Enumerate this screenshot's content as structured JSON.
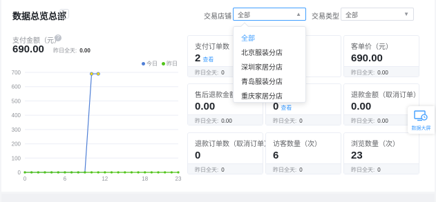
{
  "header": {
    "title": "数据总览总部",
    "store_label": "交易店铺",
    "store_value": "全部",
    "type_label": "交易类型",
    "type_value": "全部"
  },
  "store_dropdown": {
    "options": [
      "全部",
      "北京服装分店",
      "深圳家居分店",
      "青岛服装分店",
      "重庆家居分店"
    ],
    "selected": "全部"
  },
  "summary": {
    "label": "支付金额（元）",
    "value": "690.00",
    "yesterday_label": "昨日全天:",
    "yesterday_value": "0.00"
  },
  "legend": {
    "today": "今日",
    "yesterday": "昨日"
  },
  "colors": {
    "today": "#4f7fd6",
    "yesterday": "#52c41a",
    "accent": "#409eff"
  },
  "chart_data": {
    "type": "line",
    "x": [
      0,
      1,
      2,
      3,
      4,
      5,
      6,
      7,
      8,
      9,
      10,
      11,
      12,
      13,
      14,
      15,
      16,
      17,
      18,
      19,
      20,
      21,
      22,
      23
    ],
    "x_ticks": [
      "0",
      "6",
      "12",
      "18",
      "23"
    ],
    "y_ticks": [
      "0",
      "100",
      "200",
      "300",
      "400",
      "500",
      "600",
      "700"
    ],
    "ylim": [
      0,
      700
    ],
    "series": [
      {
        "name": "今日",
        "values": [
          0,
          0,
          0,
          0,
          0,
          0,
          0,
          0,
          0,
          0,
          690,
          690
        ]
      },
      {
        "name": "昨日",
        "values": [
          0,
          0,
          0,
          0,
          0,
          0,
          0,
          0,
          0,
          0,
          0,
          0,
          0,
          0,
          0,
          0,
          0,
          0,
          0,
          0,
          0,
          0,
          0,
          0
        ]
      }
    ],
    "legend": "top-right"
  },
  "cards": [
    {
      "label": "支付订单数（单",
      "value": "2",
      "link": "查看",
      "foot_label": "昨日全天:",
      "foot_value": "0"
    },
    {
      "label": "人）",
      "value": "",
      "link": "",
      "foot_label": "",
      "foot_value": ""
    },
    {
      "label": "客单价（元）",
      "value": "690.00",
      "link": "",
      "foot_label": "昨日全天:",
      "foot_value": "0.00"
    },
    {
      "label": "售后退款金额",
      "value": "0.00",
      "link": "",
      "foot_label": "昨日全天:",
      "foot_value": "0.00"
    },
    {
      "label": "数（单）",
      "value": "0",
      "link": "查看",
      "foot_label": "昨日全天:",
      "foot_value": "0"
    },
    {
      "label": "退款金额（取消订单）",
      "value": "0.00",
      "link": "",
      "foot_label": "昨日全天:",
      "foot_value": "0.00"
    },
    {
      "label": "退款订单数（取消订单）",
      "value": "0",
      "link": "",
      "foot_label": "昨日全天:",
      "foot_value": "0"
    },
    {
      "label": "访客数量（次）",
      "value": "6",
      "link": "",
      "foot_label": "昨日全天:",
      "foot_value": "0"
    },
    {
      "label": "浏览数量（次）",
      "value": "23",
      "link": "",
      "foot_label": "昨日全天:",
      "foot_value": "0"
    }
  ],
  "side_button": {
    "label": "数据大屏"
  }
}
